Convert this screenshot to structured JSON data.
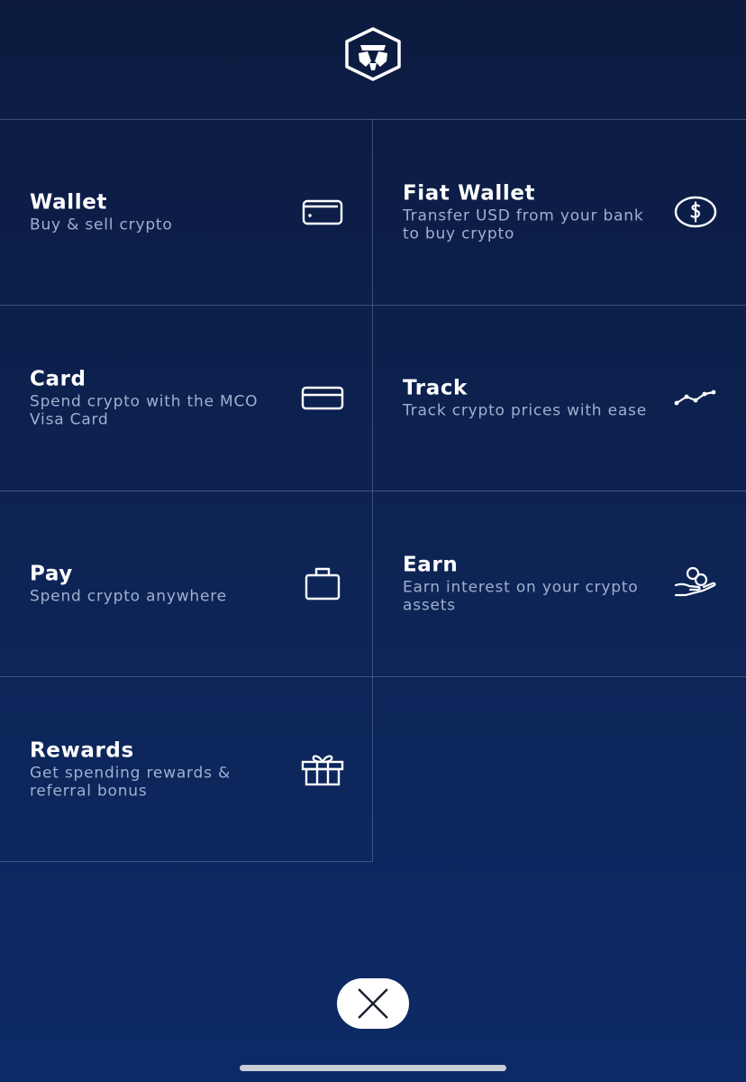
{
  "menu": {
    "items": [
      {
        "title": "Wallet",
        "subtitle": "Buy & sell crypto",
        "icon": "wallet-icon"
      },
      {
        "title": "Fiat Wallet",
        "subtitle": "Transfer USD from your bank to buy crypto",
        "icon": "dollar-circle-icon"
      },
      {
        "title": "Card",
        "subtitle": "Spend crypto with the MCO Visa Card",
        "icon": "credit-card-icon"
      },
      {
        "title": "Track",
        "subtitle": "Track crypto prices with ease",
        "icon": "line-chart-icon"
      },
      {
        "title": "Pay",
        "subtitle": "Spend crypto anywhere",
        "icon": "shopping-bag-icon"
      },
      {
        "title": "Earn",
        "subtitle": "Earn interest on your crypto assets",
        "icon": "coins-hand-icon"
      },
      {
        "title": "Rewards",
        "subtitle": "Get spending rewards & referral bonus",
        "icon": "gift-icon"
      }
    ]
  },
  "logo": {
    "icon": "lion-hexagon-logo"
  },
  "close_button": {
    "icon": "close-icon"
  },
  "colors": {
    "background_top": "#0c1b3f",
    "background_bottom": "#0c2a66",
    "subtitle": "#9fb0cf",
    "divider": "#96aad2"
  }
}
